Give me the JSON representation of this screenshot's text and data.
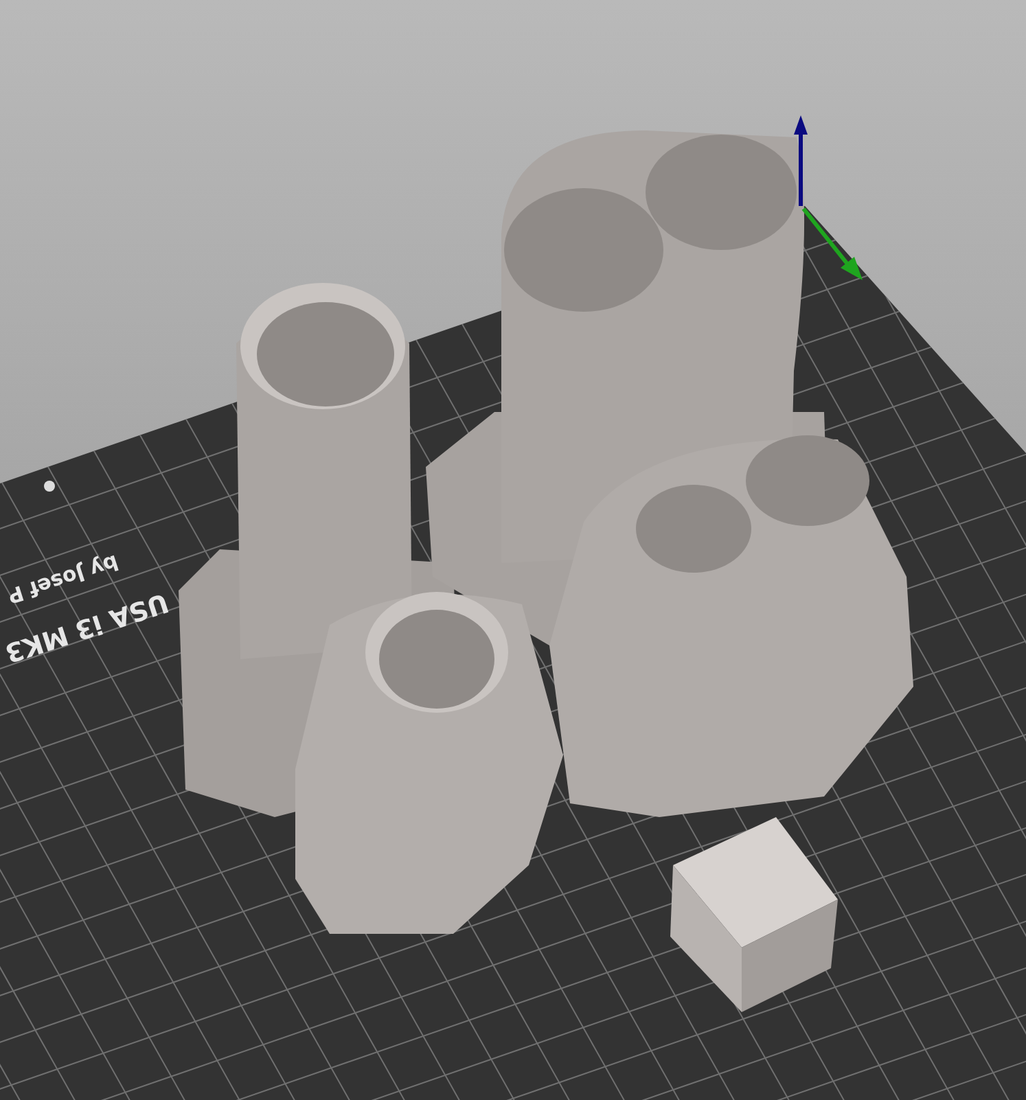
{
  "viewport": {
    "bed_texts": [
      {
        "text": "USA i3 MK3",
        "kind": "large"
      },
      {
        "text": "by Josef P",
        "kind": "small"
      }
    ]
  }
}
